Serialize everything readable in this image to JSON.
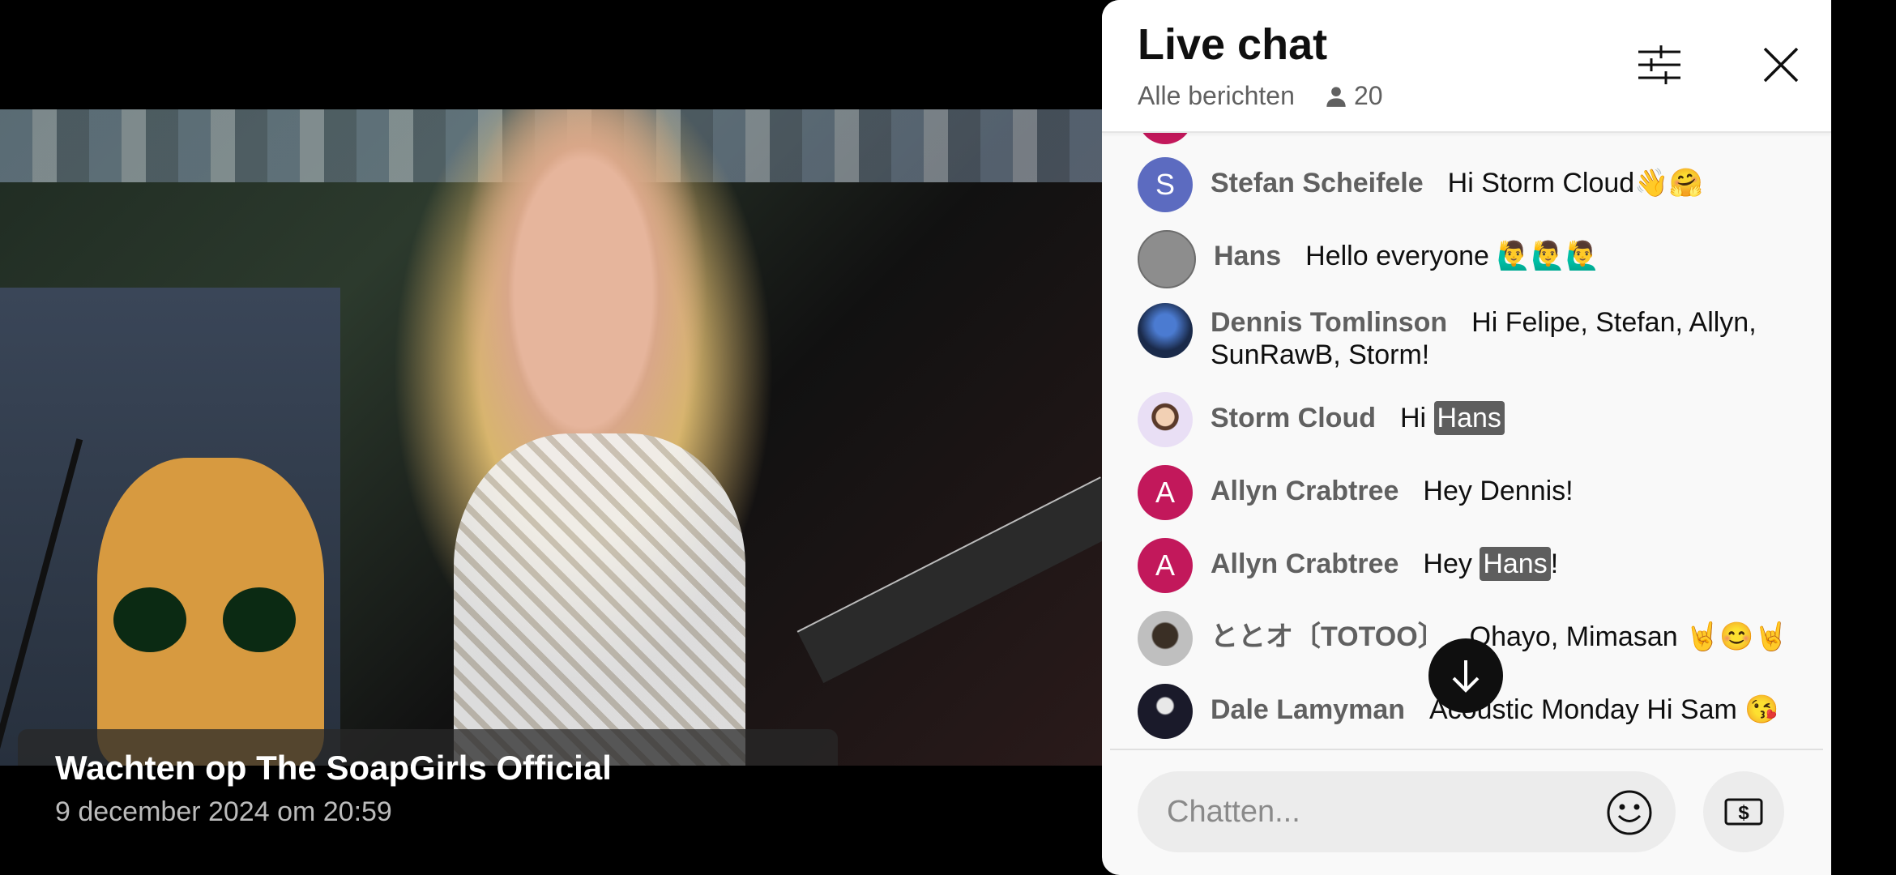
{
  "video": {
    "title": "Wachten op The SoapGirls Official",
    "date": "9 december 2024 om 20:59"
  },
  "chat": {
    "title": "Live chat",
    "filter_label": "Alle berichten",
    "viewer_count": "20",
    "input_placeholder": "Chatten...",
    "messages": [
      {
        "author": "Stefan Scheifele",
        "initial": "S",
        "avatar_color": "#5c6bc0",
        "text": "Hi Storm Cloud👋🤗"
      },
      {
        "author": "Hans",
        "initial": "",
        "avatar_color": "#8d8d8d",
        "text": "Hello everyone 🙋‍♂️🙋‍♂️🙋‍♂️"
      },
      {
        "author": "Dennis Tomlinson",
        "initial": "",
        "avatar_color": "#1a2a4a",
        "text": "Hi Felipe, Stefan, Allyn, SunRawB, Storm!"
      },
      {
        "author": "Storm Cloud",
        "initial": "",
        "avatar_color": "#e9dff5",
        "text_prefix": "Hi ",
        "mention": "Hans",
        "text_suffix": ""
      },
      {
        "author": "Allyn Crabtree",
        "initial": "A",
        "avatar_color": "#c2185b",
        "text": "Hey Dennis!"
      },
      {
        "author": "Allyn Crabtree",
        "initial": "A",
        "avatar_color": "#c2185b",
        "text_prefix": "Hey ",
        "mention": "Hans",
        "text_suffix": "!"
      },
      {
        "author": "ととオ〔TOTOO〕",
        "initial": "",
        "avatar_color": "#7a7a7a",
        "text": "Ohayo, Mimasan 🤘😊🤘"
      },
      {
        "author": "Dale Lamyman",
        "initial": "",
        "avatar_color": "#222",
        "text": "Acoustic Monday Hi Sam 😘"
      }
    ]
  },
  "icons": [
    "filter-icon",
    "close-icon",
    "person-icon",
    "arrow-down-icon",
    "emoji-icon",
    "money-icon"
  ]
}
